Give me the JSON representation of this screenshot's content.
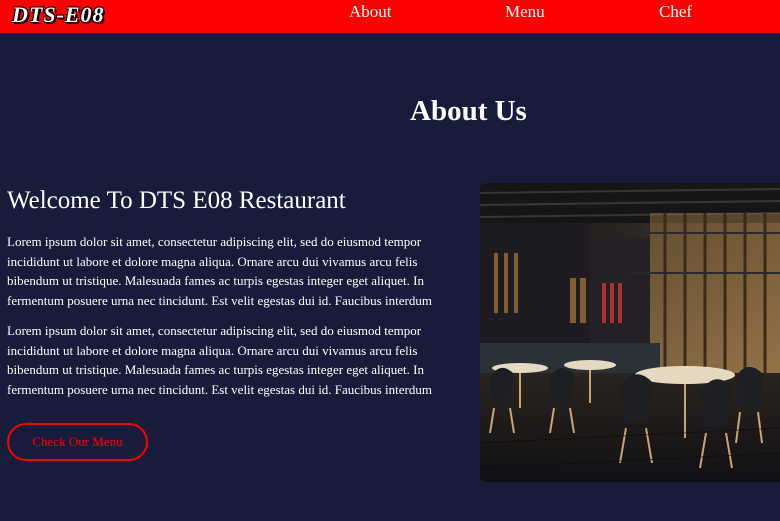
{
  "nav": {
    "logo": "DTS-E08",
    "links": [
      "About",
      "Menu",
      "Chef"
    ]
  },
  "about": {
    "title": "About Us",
    "heading": "Welcome To DTS E08 Restaurant",
    "paragraphs": [
      "Lorem ipsum dolor sit amet, consectetur adipiscing elit, sed do eiusmod tempor incididunt ut labore et dolore magna aliqua. Ornare arcu dui vivamus arcu felis bibendum ut tristique. Malesuada fames ac turpis egestas integer eget aliquet. In fermentum posuere urna nec tincidunt. Est velit egestas dui id. Faucibus interdum",
      "Lorem ipsum dolor sit amet, consectetur adipiscing elit, sed do eiusmod tempor incididunt ut labore et dolore magna aliqua. Ornare arcu dui vivamus arcu felis bibendum ut tristique. Malesuada fames ac turpis egestas integer eget aliquet. In fermentum posuere urna nec tincidunt. Est velit egestas dui id. Faucibus interdum"
    ],
    "cta_label": "Check Our Menu",
    "image_subject": "restaurant-interior"
  },
  "colors": {
    "nav_bg": "#ff0000",
    "page_bg": "#171c3a",
    "accent": "#ff0000",
    "text": "#ffffff"
  }
}
